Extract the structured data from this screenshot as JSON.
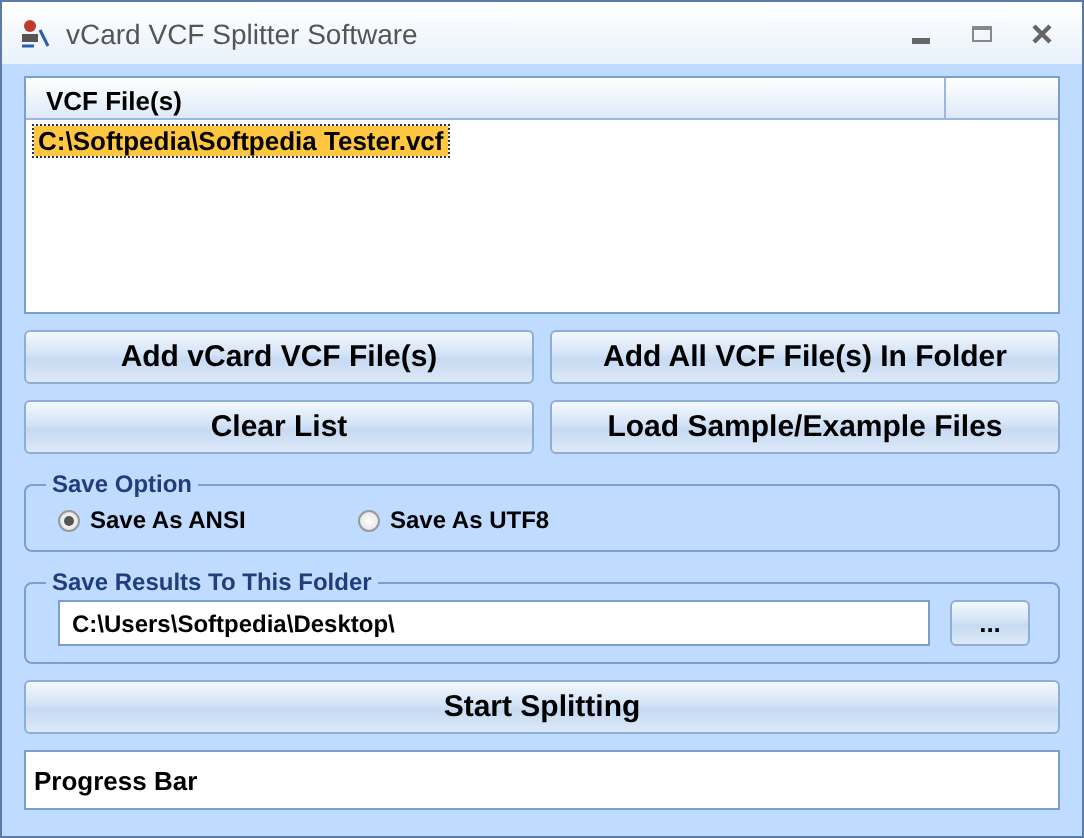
{
  "window": {
    "title": "vCard VCF Splitter Software"
  },
  "file_list": {
    "columns": [
      "VCF File(s)"
    ],
    "rows": [
      {
        "path": "C:\\Softpedia\\Softpedia Tester.vcf",
        "selected": true
      }
    ]
  },
  "button_rows": [
    {
      "buttons": [
        "Add vCard VCF File(s)",
        "Add All VCF File(s) In Folder"
      ]
    },
    {
      "buttons": [
        "Clear List",
        "Load Sample/Example Files"
      ]
    }
  ],
  "save_option": {
    "title": "Save Option",
    "options": [
      {
        "label": "Save As ANSI",
        "selected": true
      },
      {
        "label": "Save As UTF8",
        "selected": false
      }
    ]
  },
  "save_folder": {
    "title": "Save Results To This Folder",
    "value": "C:\\Users\\Softpedia\\Desktop\\",
    "browse_button": "..."
  },
  "start_button": "Start Splitting",
  "progress": {
    "label": "Progress Bar",
    "level": 0
  }
}
